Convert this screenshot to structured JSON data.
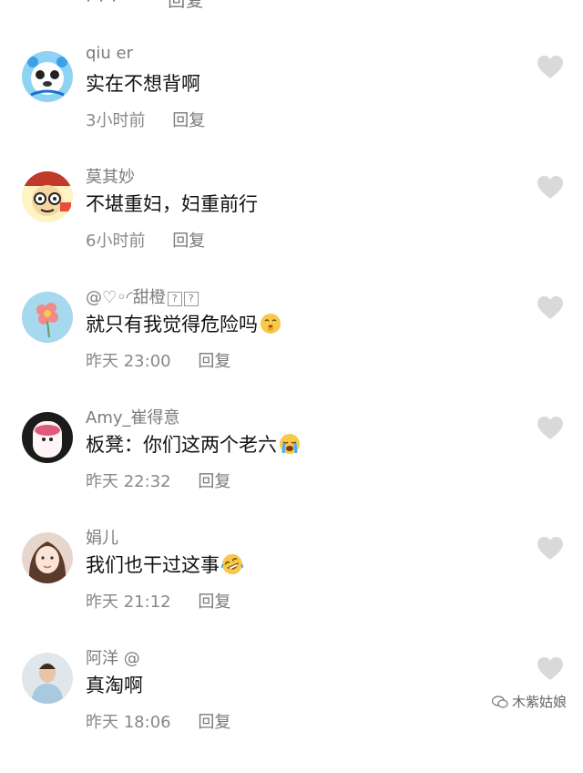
{
  "top_partial": {
    "time": "· · ·",
    "reply": "回复"
  },
  "comments": [
    {
      "username": "qiu er",
      "text": "实在不想背啊",
      "time": "3小时前",
      "reply": "回复",
      "emoji": ""
    },
    {
      "username": "莫其妙",
      "text": "不堪重妇，妇重前行",
      "time": "6小时前",
      "reply": "回复",
      "emoji": ""
    },
    {
      "username": "@♡◦◜甜橙",
      "text": "就只有我觉得危险吗",
      "time": "昨天 23:00",
      "reply": "回复",
      "emoji": "shushing-face"
    },
    {
      "username": "Amy_崔得意",
      "text": "板凳：你们这两个老六",
      "time": "昨天 22:32",
      "reply": "回复",
      "emoji": "crying-face"
    },
    {
      "username": "娟儿",
      "text": "我们也干过这事",
      "time": "昨天 21:12",
      "reply": "回复",
      "emoji": "rolling-laughing-face"
    },
    {
      "username": "阿洋 @",
      "text": "真淘啊",
      "time": "昨天 18:06",
      "reply": "回复",
      "emoji": ""
    }
  ],
  "watermark": "木紫姑娘",
  "colors": {
    "like_heart": "#d9d9d9",
    "meta_text": "#888888",
    "username_text": "#7c7c7c",
    "body_text": "#111111"
  }
}
